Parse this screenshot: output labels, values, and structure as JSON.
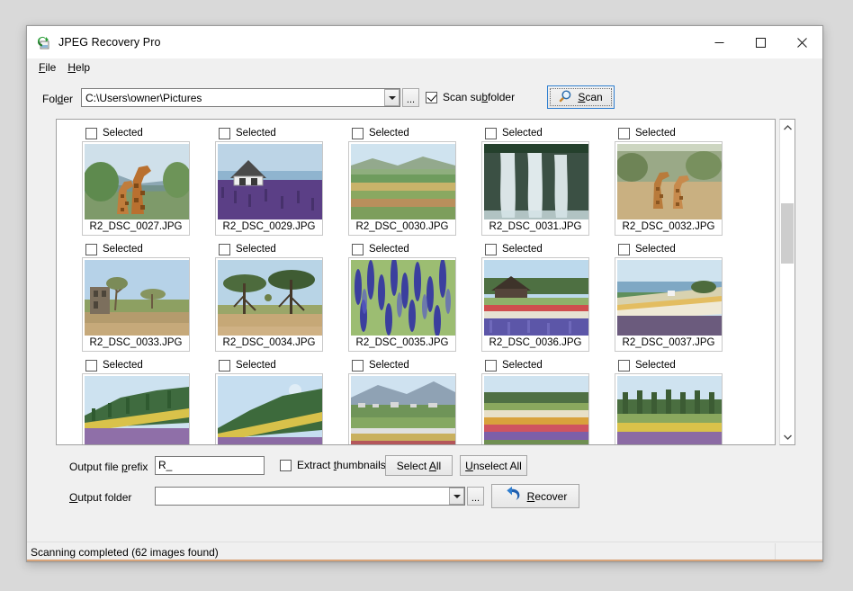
{
  "window": {
    "title": "JPEG Recovery Pro",
    "app_icon": "recovery-image-icon",
    "minimize": "─",
    "maximize": "□",
    "close": "✕"
  },
  "menubar": {
    "items": [
      {
        "label": "File",
        "mnemonic": "F",
        "rest": "ile"
      },
      {
        "label": "Help",
        "mnemonic": "H",
        "rest": "elp"
      }
    ]
  },
  "toolbar": {
    "folder_label_pre": "Fol",
    "folder_label_mn": "d",
    "folder_label_post": "er",
    "folder_value": "C:\\Users\\owner\\Pictures",
    "folder_placeholder": "",
    "browse_label": "...",
    "scan_subfolder_label_pre": "Scan su",
    "scan_subfolder_mn": "b",
    "scan_subfolder_label_post": "folder",
    "scan_subfolder_checked": true,
    "scan_button_label_mn": "S",
    "scan_button_label_post": "can",
    "scan_icon": "magnifier-icon"
  },
  "thumbnails": {
    "checkbox_label": "Selected",
    "items": [
      {
        "filename": "R2_DSC_0027.JPG",
        "selected": false,
        "scene": "giraffes"
      },
      {
        "filename": "R2_DSC_0029.JPG",
        "selected": false,
        "scene": "lavender-house"
      },
      {
        "filename": "R2_DSC_0030.JPG",
        "selected": false,
        "scene": "field-stripes"
      },
      {
        "filename": "R2_DSC_0031.JPG",
        "selected": false,
        "scene": "waterfall"
      },
      {
        "filename": "R2_DSC_0032.JPG",
        "selected": false,
        "scene": "giraffes-savanna"
      },
      {
        "filename": "R2_DSC_0033.JPG",
        "selected": false,
        "scene": "savanna-ruin"
      },
      {
        "filename": "R2_DSC_0034.JPG",
        "selected": false,
        "scene": "acacia-trees"
      },
      {
        "filename": "R2_DSC_0035.JPG",
        "selected": false,
        "scene": "blue-flowers"
      },
      {
        "filename": "R2_DSC_0036.JPG",
        "selected": false,
        "scene": "barn-flowerfield"
      },
      {
        "filename": "R2_DSC_0037.JPG",
        "selected": false,
        "scene": "coastal-field"
      },
      {
        "filename": "",
        "selected": false,
        "scene": "lavender-hill"
      },
      {
        "filename": "",
        "selected": false,
        "scene": "lavender-hill2"
      },
      {
        "filename": "",
        "selected": false,
        "scene": "valley-town"
      },
      {
        "filename": "",
        "selected": false,
        "scene": "flower-rows"
      },
      {
        "filename": "",
        "selected": false,
        "scene": "tree-row-field"
      }
    ]
  },
  "bottom": {
    "prefix_label_pre": "Output file ",
    "prefix_label_mn": "p",
    "prefix_label_post": "refix",
    "prefix_value": "R_",
    "extract_label_pre": "Extract ",
    "extract_label_mn": "t",
    "extract_label_post": "humbnails",
    "extract_checked": false,
    "select_all_pre": "Select ",
    "select_all_mn": "A",
    "select_all_post": "ll",
    "unselect_all_mn": "U",
    "unselect_all_post": "nselect All",
    "outfolder_label_mn": "O",
    "outfolder_label_post": "utput folder",
    "outfolder_value": "",
    "outfolder_browse": "...",
    "recover_mn": "R",
    "recover_post": "ecover",
    "recover_icon": "restore-arrow-icon"
  },
  "statusbar": {
    "text": "Scanning completed (62 images found)",
    "grip": "resize-grip"
  },
  "colors": {
    "accent_blue": "#2f7fd0",
    "window_bg": "#f0f0f0",
    "panel_bg": "#ffffff",
    "status_accent": "#d8a47a"
  }
}
